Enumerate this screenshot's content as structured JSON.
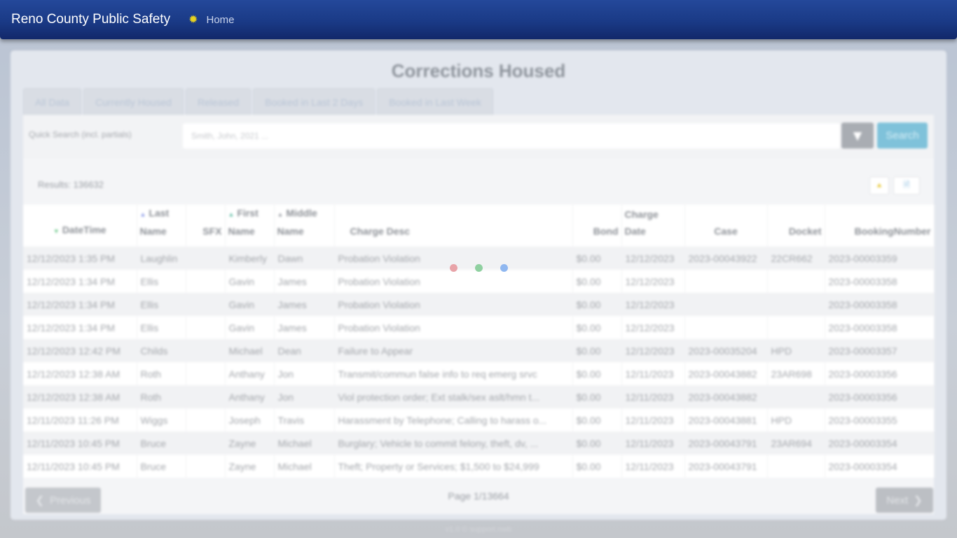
{
  "navbar": {
    "brand": "Reno County Public Safety",
    "home_label": "Home",
    "home_icon": "sun-icon"
  },
  "page": {
    "title": "Corrections Housed"
  },
  "tabs": [
    {
      "label": "All Data"
    },
    {
      "label": "Currently Housed"
    },
    {
      "label": "Released"
    },
    {
      "label": "Booked in Last 2 Days"
    },
    {
      "label": "Booked in Last Week"
    }
  ],
  "search": {
    "label": "Quick Search (incl. partials)",
    "placeholder": "Smith, John, 2021 ...",
    "value": "",
    "filter_icon": "filter-icon",
    "button_label": "Search"
  },
  "results": {
    "text": "Results: 136632",
    "export_icons": [
      "pdf-icon",
      "document-icon"
    ]
  },
  "table": {
    "columns": [
      {
        "label": "DateTime",
        "sort": "down"
      },
      {
        "label": "Last Name",
        "sort": "up"
      },
      {
        "label": "SFX",
        "sort": ""
      },
      {
        "label": "First Name",
        "sort": "up"
      },
      {
        "label": "Middle Name",
        "sort": "up"
      },
      {
        "label": "Charge Desc",
        "sort": ""
      },
      {
        "label": "Bond",
        "sort": ""
      },
      {
        "label": "Charge Date",
        "sort": ""
      },
      {
        "label": "Case",
        "sort": ""
      },
      {
        "label": "Docket",
        "sort": ""
      },
      {
        "label": "BookingNumber",
        "sort": ""
      }
    ],
    "rows": [
      [
        "12/12/2023 1:35 PM",
        "Laughlin",
        "",
        "Kimberly",
        "Dawn",
        "Probation Violation",
        "$0.00",
        "12/12/2023",
        "2023-00043922",
        "22CR662",
        "2023-00003359"
      ],
      [
        "12/12/2023 1:34 PM",
        "Ellis",
        "",
        "Gavin",
        "James",
        "Probation Violation",
        "$0.00",
        "12/12/2023",
        "",
        "",
        "2023-00003358"
      ],
      [
        "12/12/2023 1:34 PM",
        "Ellis",
        "",
        "Gavin",
        "James",
        "Probation Violation",
        "$0.00",
        "12/12/2023",
        "",
        "",
        "2023-00003358"
      ],
      [
        "12/12/2023 1:34 PM",
        "Ellis",
        "",
        "Gavin",
        "James",
        "Probation Violation",
        "$0.00",
        "12/12/2023",
        "",
        "",
        "2023-00003358"
      ],
      [
        "12/12/2023 12:42 PM",
        "Childs",
        "",
        "Michael",
        "Dean",
        "Failure to Appear",
        "$0.00",
        "12/12/2023",
        "2023-00035204",
        "HPD",
        "2023-00003357"
      ],
      [
        "12/12/2023 12:38 AM",
        "Roth",
        "",
        "Anthany",
        "Jon",
        "Transmit/commun false info to req emerg srvc",
        "$0.00",
        "12/11/2023",
        "2023-00043882",
        "23AR698",
        "2023-00003356"
      ],
      [
        "12/12/2023 12:38 AM",
        "Roth",
        "",
        "Anthany",
        "Jon",
        "Viol protection order; Ext stalk/sex aslt/hmn t...",
        "$0.00",
        "12/11/2023",
        "2023-00043882",
        "",
        "2023-00003356"
      ],
      [
        "12/11/2023 11:26 PM",
        "Wiggs",
        "",
        "Joseph",
        "Travis",
        "Harassment by Telephone; Calling to harass o...",
        "$0.00",
        "12/11/2023",
        "2023-00043881",
        "HPD",
        "2023-00003355"
      ],
      [
        "12/11/2023 10:45 PM",
        "Bruce",
        "",
        "Zayne",
        "Michael",
        "Burglary; Vehicle to commit felony, theft, dv, ...",
        "$0.00",
        "12/11/2023",
        "2023-00043791",
        "23AR694",
        "2023-00003354"
      ],
      [
        "12/11/2023 10:45 PM",
        "Bruce",
        "",
        "Zayne",
        "Michael",
        "Theft; Property or Services; $1,500 to $24,999",
        "$0.00",
        "12/11/2023",
        "2023-00043791",
        "",
        "2023-00003354"
      ]
    ]
  },
  "loading": {
    "dot_colors": [
      "#e8a3a8",
      "#8fd0a0",
      "#8fb7f0"
    ]
  },
  "pager": {
    "prev_label": "Previous",
    "next_label": "Next",
    "page_text": "Page 1/13664"
  },
  "footer": {
    "text": "v1.0 © support.nwb"
  }
}
